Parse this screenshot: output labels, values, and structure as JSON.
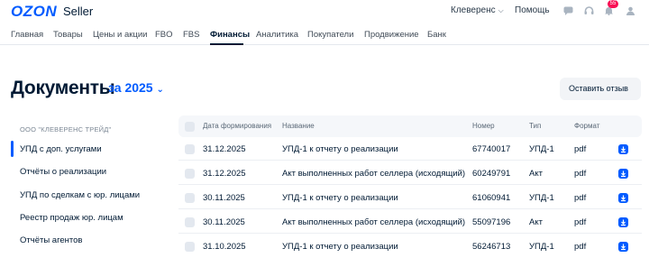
{
  "header": {
    "logo": "OZON",
    "product": "Seller",
    "company": "Клеверенс",
    "help": "Помощь",
    "notifications_count": "55",
    "icons": [
      "chat-icon",
      "headset-icon",
      "bell-icon",
      "avatar-icon"
    ]
  },
  "nav": {
    "items": [
      "Главная",
      "Товары",
      "Цены и акции",
      "FBO",
      "FBS",
      "Финансы",
      "Аналитика",
      "Покупатели",
      "Продвижение",
      "Банк"
    ],
    "active": "Финансы"
  },
  "page": {
    "title": "Документы",
    "period": "за 2025",
    "review_button": "Оставить отзыв"
  },
  "sidebar": {
    "organization": "ООО \"КЛЕВЕРЕНС ТРЕЙД\"",
    "items": [
      "УПД с доп. услугами",
      "Отчёты о реализации",
      "УПД по сделкам с юр. лицами",
      "Реестр продаж юр. лицам",
      "Отчёты агентов"
    ],
    "active": "УПД с доп. услугами"
  },
  "table": {
    "columns": [
      "Дата формирования",
      "Название",
      "Номер",
      "Тип",
      "Формат"
    ],
    "rows": [
      {
        "date": "31.12.2025",
        "name": "УПД-1 к отчету о реализации",
        "number": "67740017",
        "type": "УПД-1",
        "format": "pdf"
      },
      {
        "date": "31.12.2025",
        "name": "Акт выполненных работ селлера (исходящий)",
        "number": "60249791",
        "type": "Акт",
        "format": "pdf"
      },
      {
        "date": "30.11.2025",
        "name": "УПД-1 к отчету о реализации",
        "number": "61060941",
        "type": "УПД-1",
        "format": "pdf"
      },
      {
        "date": "30.11.2025",
        "name": "Акт выполненных работ селлера (исходящий)",
        "number": "55097196",
        "type": "Акт",
        "format": "pdf"
      },
      {
        "date": "31.10.2025",
        "name": "УПД-1 к отчету о реализации",
        "number": "56246713",
        "type": "УПД-1",
        "format": "pdf"
      }
    ]
  },
  "colors": {
    "accent": "#005bff",
    "badge": "#f91155",
    "text": "#001a34"
  }
}
